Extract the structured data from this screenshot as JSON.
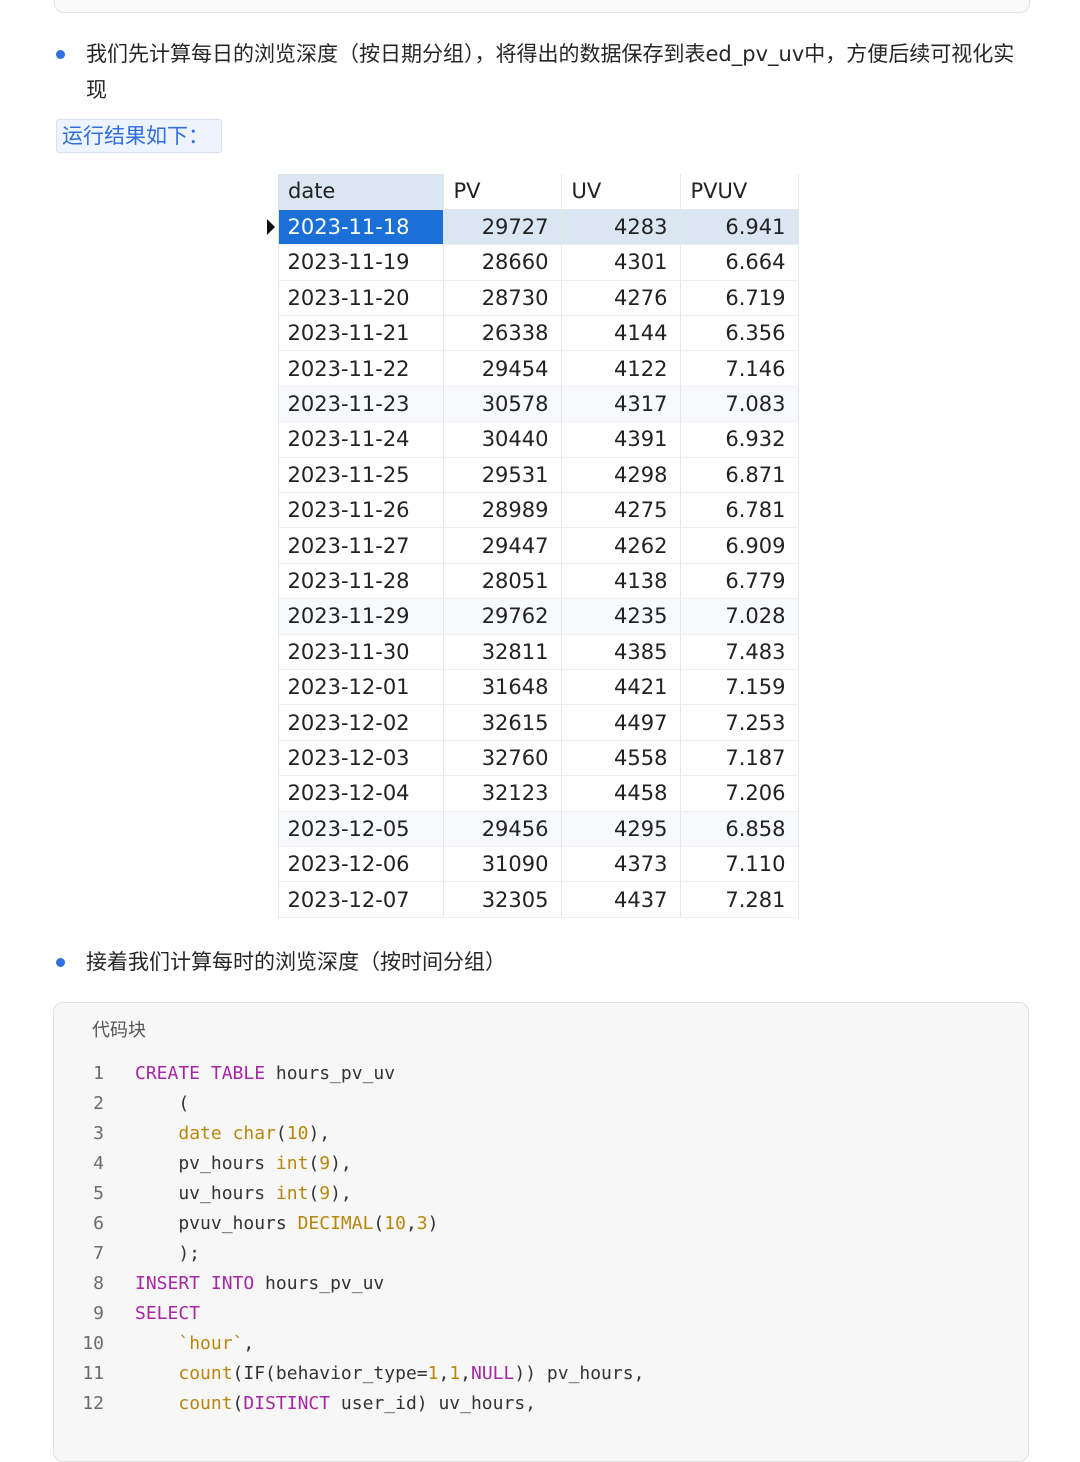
{
  "bullets": [
    "我们先计算每日的浏览深度（按日期分组），将得出的数据保存到表ed_pv_uv中，方便后续可视化实现",
    "接着我们计算每时的浏览深度（按时间分组）"
  ],
  "result_label": "运行结果如下：",
  "table": {
    "columns": [
      "date",
      "PV",
      "UV",
      "PVUV"
    ],
    "rows": [
      [
        "2023-11-18",
        "29727",
        "4283",
        "6.941"
      ],
      [
        "2023-11-19",
        "28660",
        "4301",
        "6.664"
      ],
      [
        "2023-11-20",
        "28730",
        "4276",
        "6.719"
      ],
      [
        "2023-11-21",
        "26338",
        "4144",
        "6.356"
      ],
      [
        "2023-11-22",
        "29454",
        "4122",
        "7.146"
      ],
      [
        "2023-11-23",
        "30578",
        "4317",
        "7.083"
      ],
      [
        "2023-11-24",
        "30440",
        "4391",
        "6.932"
      ],
      [
        "2023-11-25",
        "29531",
        "4298",
        "6.871"
      ],
      [
        "2023-11-26",
        "28989",
        "4275",
        "6.781"
      ],
      [
        "2023-11-27",
        "29447",
        "4262",
        "6.909"
      ],
      [
        "2023-11-28",
        "28051",
        "4138",
        "6.779"
      ],
      [
        "2023-11-29",
        "29762",
        "4235",
        "7.028"
      ],
      [
        "2023-11-30",
        "32811",
        "4385",
        "7.483"
      ],
      [
        "2023-12-01",
        "31648",
        "4421",
        "7.159"
      ],
      [
        "2023-12-02",
        "32615",
        "4497",
        "7.253"
      ],
      [
        "2023-12-03",
        "32760",
        "4558",
        "7.187"
      ],
      [
        "2023-12-04",
        "32123",
        "4458",
        "7.206"
      ],
      [
        "2023-12-05",
        "29456",
        "4295",
        "6.858"
      ],
      [
        "2023-12-06",
        "31090",
        "4373",
        "7.110"
      ],
      [
        "2023-12-07",
        "32305",
        "4437",
        "7.281"
      ]
    ]
  },
  "code_block": {
    "title": "代码块",
    "lines": [
      [
        [
          "kw",
          "CREATE TABLE"
        ],
        [
          "",
          " hours_pv_uv"
        ]
      ],
      [
        [
          "",
          "    ("
        ]
      ],
      [
        [
          "",
          "    "
        ],
        [
          "fn",
          "date"
        ],
        [
          "",
          " "
        ],
        [
          "fn",
          "char"
        ],
        [
          "",
          "("
        ],
        [
          "num",
          "10"
        ],
        [
          "",
          "),"
        ]
      ],
      [
        [
          "",
          "    pv_hours "
        ],
        [
          "fn",
          "int"
        ],
        [
          "",
          "("
        ],
        [
          "num",
          "9"
        ],
        [
          "",
          "),"
        ]
      ],
      [
        [
          "",
          "    uv_hours "
        ],
        [
          "fn",
          "int"
        ],
        [
          "",
          "("
        ],
        [
          "num",
          "9"
        ],
        [
          "",
          "),"
        ]
      ],
      [
        [
          "",
          "    pvuv_hours "
        ],
        [
          "fn",
          "DECIMAL"
        ],
        [
          "",
          "("
        ],
        [
          "num",
          "10"
        ],
        [
          "",
          ","
        ],
        [
          "num",
          "3"
        ],
        [
          "",
          ")"
        ]
      ],
      [
        [
          "",
          "    );"
        ]
      ],
      [
        [
          "kw",
          "INSERT INTO"
        ],
        [
          "",
          " hours_pv_uv"
        ]
      ],
      [
        [
          "kw",
          "SELECT"
        ]
      ],
      [
        [
          "",
          "    "
        ],
        [
          "fn",
          "`hour`"
        ],
        [
          "",
          ","
        ]
      ],
      [
        [
          "",
          "    "
        ],
        [
          "fn",
          "count"
        ],
        [
          "",
          "(IF(behavior_type="
        ],
        [
          "num",
          "1"
        ],
        [
          "",
          ","
        ],
        [
          "num",
          "1"
        ],
        [
          "",
          ","
        ],
        [
          "kw",
          "NULL"
        ],
        [
          "",
          ")) pv_hours,"
        ]
      ],
      [
        [
          "",
          "    "
        ],
        [
          "fn",
          "count"
        ],
        [
          "",
          "("
        ],
        [
          "kw",
          "DISTINCT"
        ],
        [
          "",
          " user_id) uv_hours,"
        ]
      ]
    ]
  }
}
